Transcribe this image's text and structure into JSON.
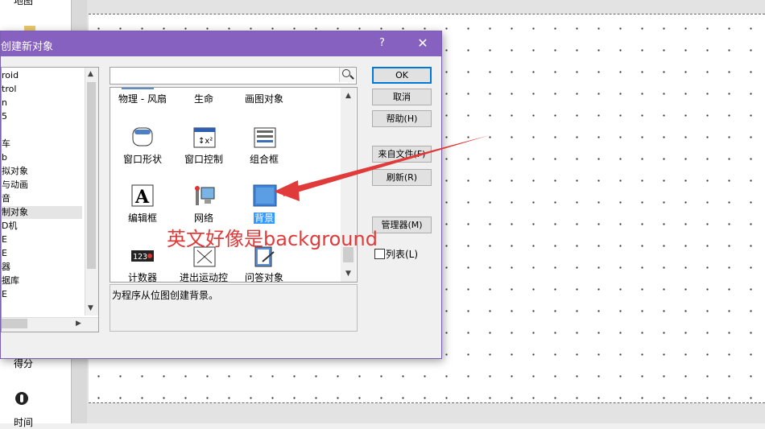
{
  "background": {
    "side_labels": [
      "地图",
      "得分",
      "时间"
    ]
  },
  "dialog": {
    "title": "创建新对象",
    "help": "?",
    "close": "✕",
    "categories": [
      "roid",
      "trol",
      "n",
      "5",
      "",
      "车",
      "b",
      "拟对象",
      "与动画",
      "音",
      "制对象",
      "D机",
      "E",
      "E",
      "器",
      "据库",
      "E"
    ],
    "selected_category_index": 10,
    "search": {
      "value": "",
      "placeholder": ""
    },
    "objects_row0": [
      "物理 - 风扇",
      "生命",
      "画图对象"
    ],
    "objects": [
      {
        "label": "窗口形状",
        "icon": "window-shape-icon"
      },
      {
        "label": "窗口控制",
        "icon": "window-control-icon"
      },
      {
        "label": "组合框",
        "icon": "combo-box-icon"
      },
      {
        "label": "编辑框",
        "icon": "edit-box-icon"
      },
      {
        "label": "网络",
        "icon": "network-icon"
      },
      {
        "label": "背景",
        "icon": "background-icon"
      },
      {
        "label": "计数器",
        "icon": "counter-icon"
      },
      {
        "label": "进出运动控",
        "icon": "movement-control-icon"
      },
      {
        "label": "问答对象",
        "icon": "question-answer-icon"
      }
    ],
    "selected_object": "背景",
    "counter_digits": "123",
    "description": "为程序从位图创建背景。",
    "buttons": {
      "ok": "OK",
      "cancel": "取消",
      "help": "帮助(H)",
      "from_file": "来自文件(F)",
      "refresh": "刷新(R)",
      "manager": "管理器(M)"
    },
    "list_checkbox": {
      "label": "列表(L)",
      "checked": false
    }
  },
  "annotation": {
    "text": "英文好像是background",
    "color": "#e03a3a"
  },
  "colors": {
    "title_bar": "#8661c0",
    "selection": "#3399ff",
    "default_button_border": "#0078d7"
  }
}
